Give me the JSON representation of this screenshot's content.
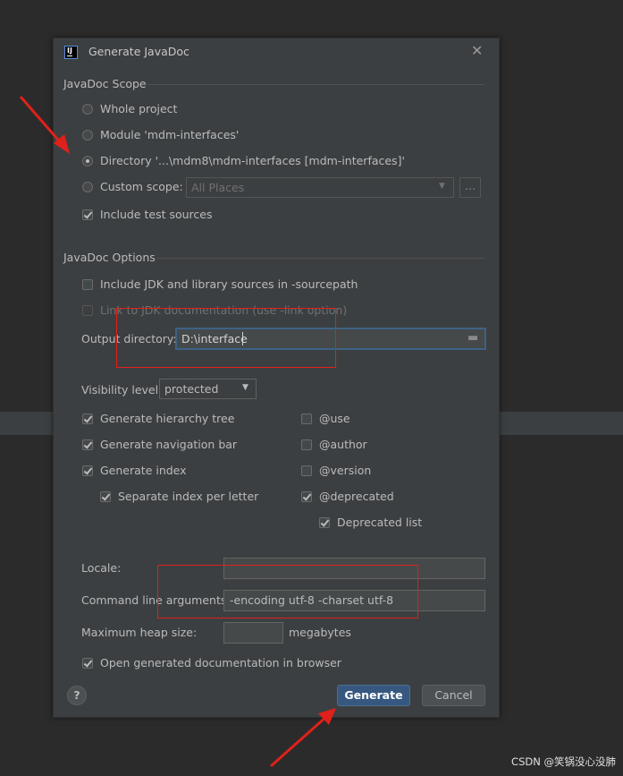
{
  "dialog": {
    "title": "Generate JavaDoc",
    "scope_title": "JavaDoc Scope",
    "scope_options": [
      "Whole project",
      "Module 'mdm-interfaces'",
      "Directory '...\\mdm8\\mdm-interfaces [mdm-interfaces]'",
      "Custom scope:"
    ],
    "custom_scope_value": "All Places",
    "include_test_sources": "Include test sources",
    "options_title": "JavaDoc Options",
    "include_jdk": "Include JDK and library sources in -sourcepath",
    "link_jdk": "Link to JDK documentation (use -link option)",
    "output_dir_label": "Output directory:",
    "output_dir_value": "D:\\interface",
    "visibility_label": "Visibility level:",
    "visibility_value": "protected",
    "left_checks": [
      "Generate hierarchy tree",
      "Generate navigation bar",
      "Generate index",
      "Separate index per letter"
    ],
    "right_checks": [
      "@use",
      "@author",
      "@version",
      "@deprecated",
      "Deprecated list"
    ],
    "locale_label": "Locale:",
    "locale_value": "",
    "cmd_label": "Command line arguments:",
    "cmd_value": "-encoding utf-8 -charset utf-8",
    "heap_label": "Maximum heap size:",
    "heap_value": "",
    "heap_unit": "megabytes",
    "open_browser": "Open generated documentation in browser",
    "help": "?",
    "generate": "Generate",
    "cancel": "Cancel"
  },
  "watermark": "CSDN @笑锅没心没肺",
  "colors": {
    "background": "#2b2b2b",
    "dialog": "#3c3f41",
    "primary_button": "#365880",
    "annotation": "#e0201a"
  }
}
